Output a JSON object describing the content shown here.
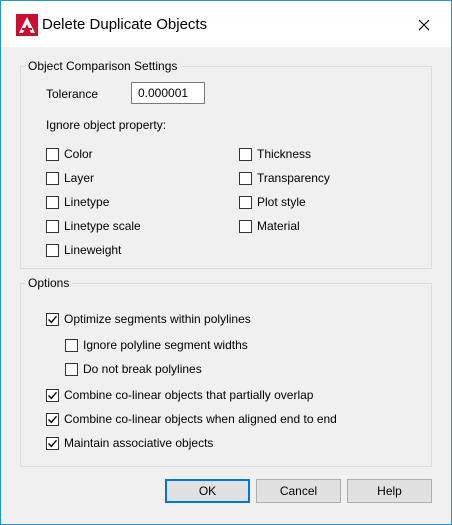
{
  "window": {
    "title": "Delete Duplicate Objects"
  },
  "comparison": {
    "legend": "Object Comparison Settings",
    "tolerance_label": "Tolerance",
    "tolerance_value": "0.000001",
    "ignore_label": "Ignore object property:",
    "properties": {
      "color": {
        "label": "Color",
        "checked": false
      },
      "layer": {
        "label": "Layer",
        "checked": false
      },
      "linetype": {
        "label": "Linetype",
        "checked": false
      },
      "linetype_scale": {
        "label": "Linetype scale",
        "checked": false
      },
      "lineweight": {
        "label": "Lineweight",
        "checked": false
      },
      "thickness": {
        "label": "Thickness",
        "checked": false
      },
      "transparency": {
        "label": "Transparency",
        "checked": false
      },
      "plot_style": {
        "label": "Plot style",
        "checked": false
      },
      "material": {
        "label": "Material",
        "checked": false
      }
    }
  },
  "options": {
    "legend": "Options",
    "optimize": {
      "label": "Optimize segments within polylines",
      "checked": true
    },
    "ignore_widths": {
      "label": "Ignore polyline segment widths",
      "checked": false
    },
    "no_break": {
      "label": "Do not break polylines",
      "checked": false
    },
    "combine_overlap": {
      "label": "Combine co-linear objects that partially overlap",
      "checked": true
    },
    "combine_end": {
      "label": "Combine co-linear objects when aligned end to end",
      "checked": true
    },
    "maintain_assoc": {
      "label": "Maintain associative objects",
      "checked": true
    }
  },
  "buttons": {
    "ok": "OK",
    "cancel": "Cancel",
    "help": "Help"
  },
  "colors": {
    "accent": "#0078d7",
    "brand": "#c8102e",
    "dialog_bg": "#f0f0f0"
  }
}
